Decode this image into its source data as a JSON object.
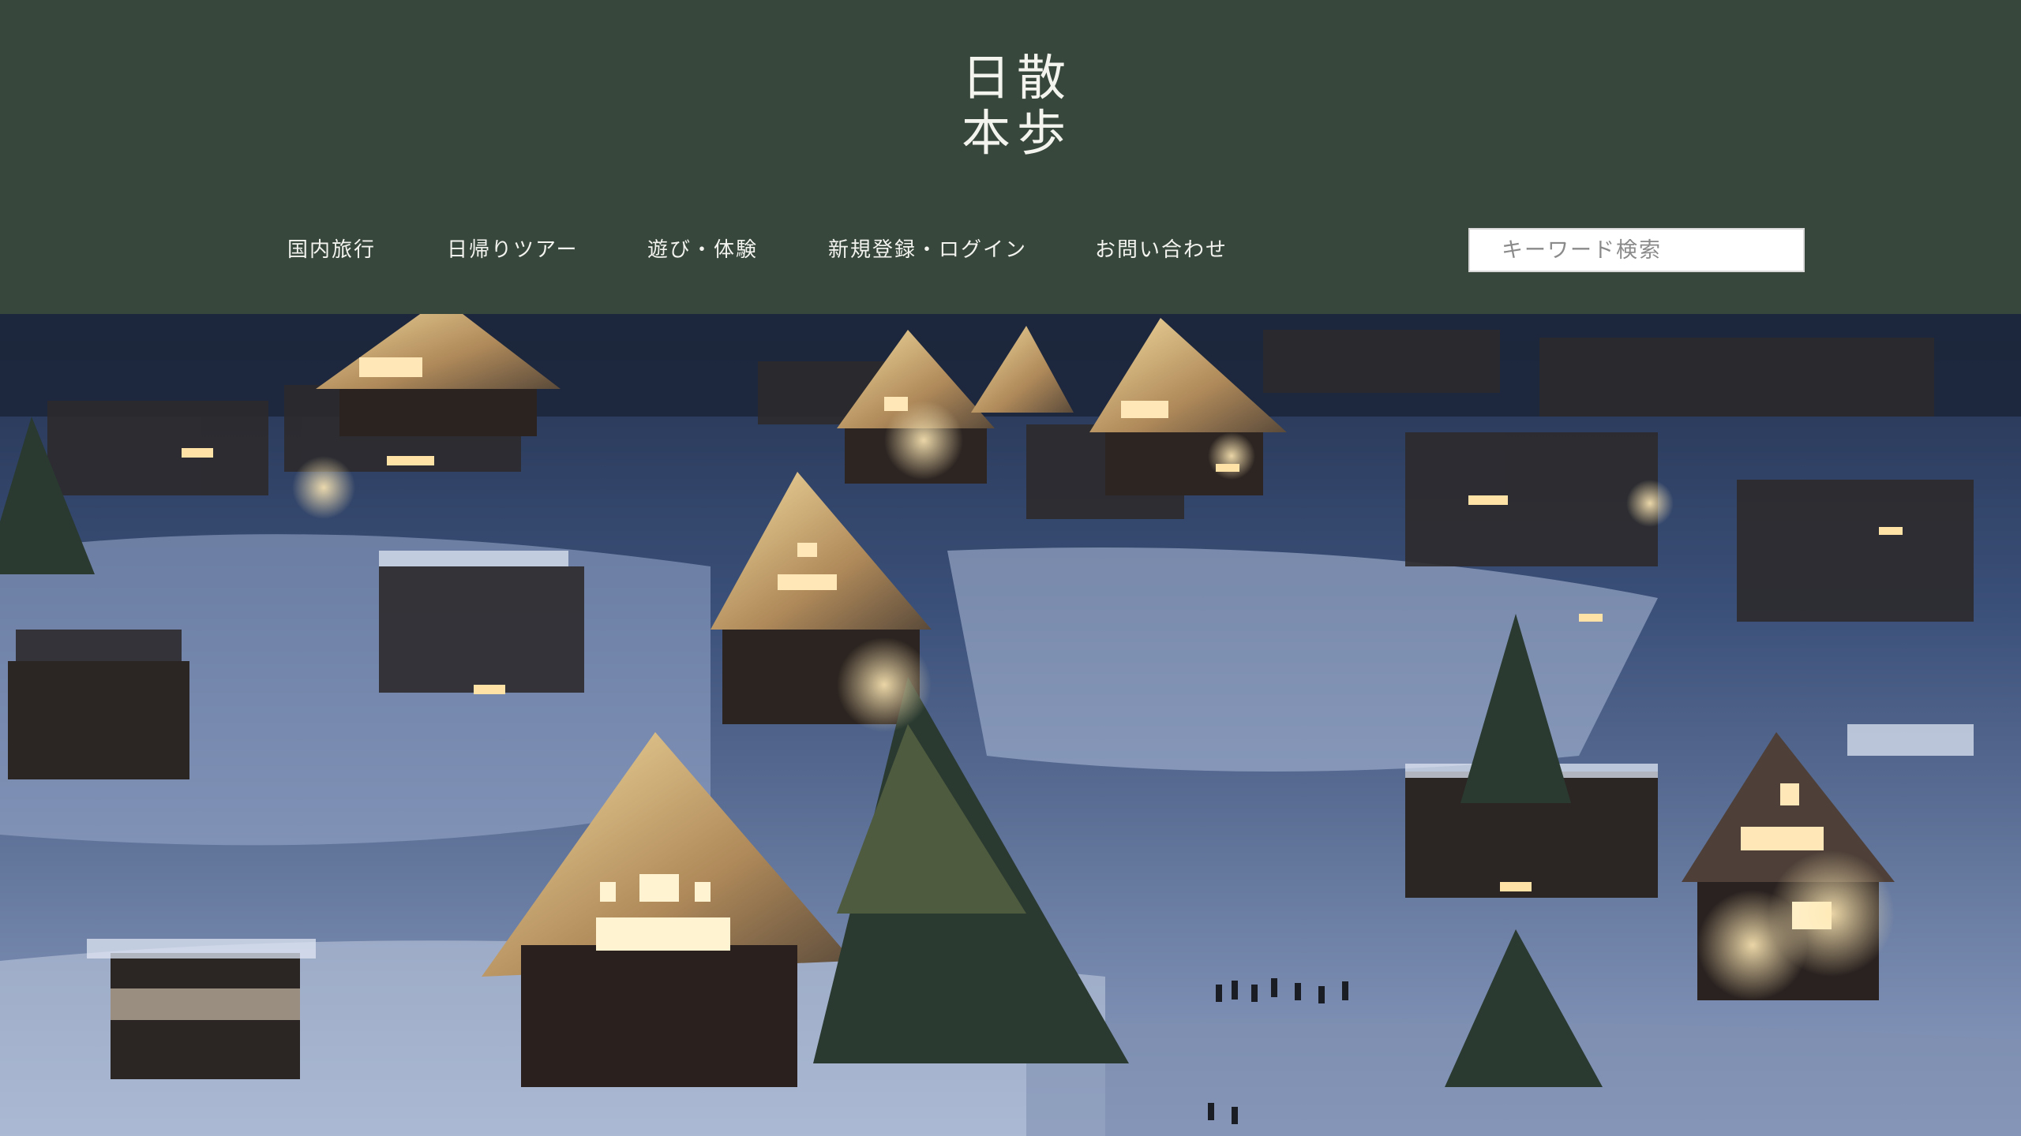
{
  "site": {
    "logo_chars": [
      "散",
      "歩",
      "日",
      "本"
    ]
  },
  "nav": {
    "items": [
      {
        "label": "国内旅行"
      },
      {
        "label": "日帰りツアー"
      },
      {
        "label": "遊び・体験"
      },
      {
        "label": "新規登録・ログイン"
      },
      {
        "label": "お問い合わせ"
      }
    ]
  },
  "search": {
    "placeholder": "キーワード検索",
    "value": ""
  },
  "hero": {
    "image": "snowy-village-night-photo"
  },
  "colors": {
    "header_bg": "#37473b",
    "header_text": "#f3f3f0",
    "night_sky": "#1c2740",
    "snow": "#cdd6ea",
    "window_light": "#fff3d2"
  }
}
